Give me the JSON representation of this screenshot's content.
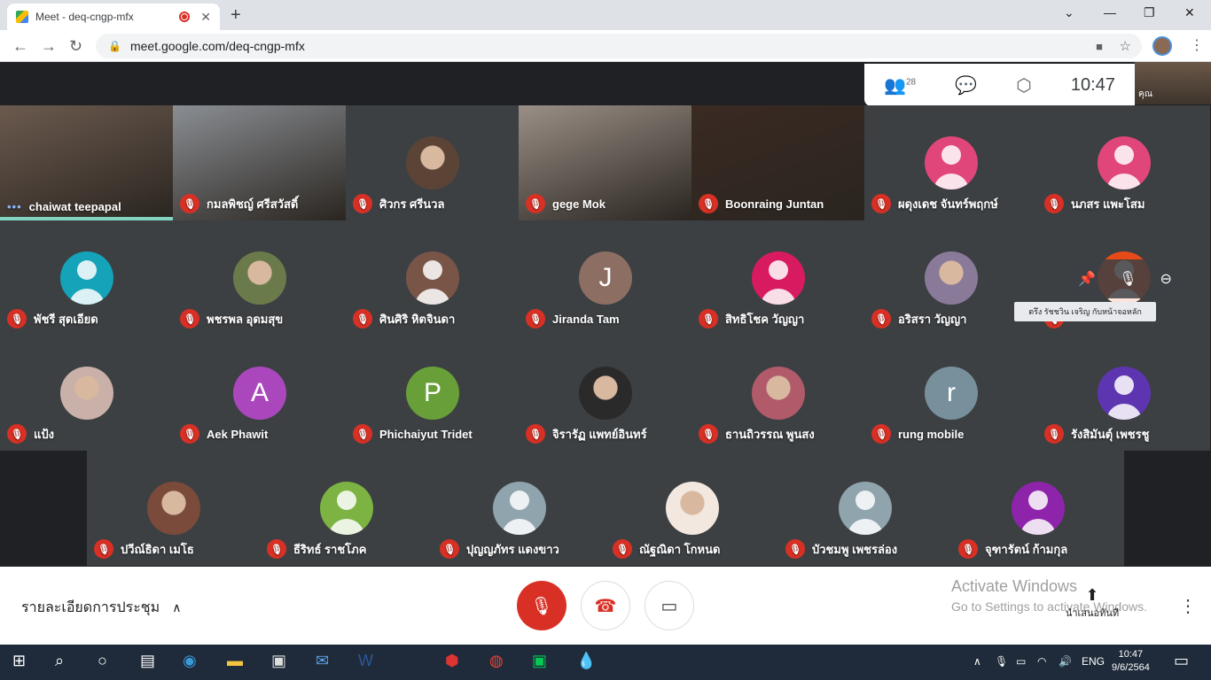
{
  "browser": {
    "tab_title": "Meet - deq-cngp-mfx",
    "tab_close": "✕",
    "new_tab": "+",
    "url": "meet.google.com/deq-cngp-mfx",
    "win_min": "—",
    "win_max": "❐",
    "win_close": "✕"
  },
  "topbar": {
    "people_count": "28",
    "time": "10:47",
    "self_label": "คุณ"
  },
  "tiles": [
    {
      "name": "chaiwat teepapal",
      "style": "video",
      "color": "#6b5a4e",
      "speaking": true
    },
    {
      "name": "กมลพิชญ์ ศรีสวัสดิ์",
      "style": "video",
      "color": "#8a8e93"
    },
    {
      "name": "ศิวกร ศรีนวล",
      "style": "photo",
      "color": "#5b4436"
    },
    {
      "name": "gege Mok",
      "style": "video",
      "color": "#9a8f86"
    },
    {
      "name": "Boonraing Juntan",
      "style": "video",
      "color": "#3a2a22"
    },
    {
      "name": "ผดุงเดช จันทร์พฤกษ์",
      "style": "person",
      "color": "#e0467a"
    },
    {
      "name": "นภสร แพะโสม",
      "style": "person",
      "color": "#e0467a"
    },
    {
      "name": "พัชรี สุดเอียด",
      "style": "person",
      "color": "#14a3b8"
    },
    {
      "name": "พชรพล อุดมสุข",
      "style": "photo",
      "color": "#6b7a4a"
    },
    {
      "name": "ศินศิริ หิตจินดา",
      "style": "person",
      "color": "#795548"
    },
    {
      "name": "Jiranda Tam",
      "style": "letter",
      "letter": "J",
      "color": "#8d6e63"
    },
    {
      "name": "สิทธิโชค วัญญา",
      "style": "person",
      "color": "#d81b60"
    },
    {
      "name": "อริสรา วัญญา",
      "style": "photo",
      "color": "#8a7a9a"
    },
    {
      "name": "",
      "style": "person",
      "color": "#e64a19"
    },
    {
      "name": "แป้ง",
      "style": "photo",
      "color": "#c9b0a8"
    },
    {
      "name": "Aek Phawit",
      "style": "letter",
      "letter": "A",
      "color": "#ab47bc"
    },
    {
      "name": "Phichaiyut Tridet",
      "style": "letter",
      "letter": "P",
      "color": "#689f38"
    },
    {
      "name": "จิรารัฏ แพทย์อินทร์",
      "style": "photo",
      "color": "#2a2a2a"
    },
    {
      "name": "ธานถิวรรณ พูนสง",
      "style": "photo",
      "color": "#b05a6a"
    },
    {
      "name": "rung mobile",
      "style": "letter",
      "letter": "r",
      "color": "#78909c"
    },
    {
      "name": "รังสิมันตุ์ เพชรชู",
      "style": "person",
      "color": "#5e35b1"
    },
    {
      "name": "ปวีณ์ธิดา เมโธ",
      "style": "photo",
      "color": "#7a4a3a"
    },
    {
      "name": "ธีริทธ์ ราชโภค",
      "style": "person",
      "color": "#7cb342"
    },
    {
      "name": "ปุญญภัทร แดงขาว",
      "style": "person",
      "color": "#90a4ae"
    },
    {
      "name": "ณัฐณิดา โกหนด",
      "style": "photo",
      "color": "#f2e8e0"
    },
    {
      "name": "บัวชมพู เพชรล่อง",
      "style": "person",
      "color": "#90a4ae"
    },
    {
      "name": "จุฑารัตน์ ก้ามกุล",
      "style": "person",
      "color": "#8e24aa"
    }
  ],
  "tooltip": "ตรึง รัชชวิน เจริญ กับหน้าจอหลัก",
  "bottom": {
    "details_label": "รายละเอียดการประชุม",
    "activate_title": "Activate Windows",
    "activate_sub": "Go to Settings to activate Windows.",
    "present_label": "นำเสนอทันที"
  },
  "taskbar": {
    "lang": "ENG",
    "time": "10:47",
    "date": "9/6/2564"
  }
}
